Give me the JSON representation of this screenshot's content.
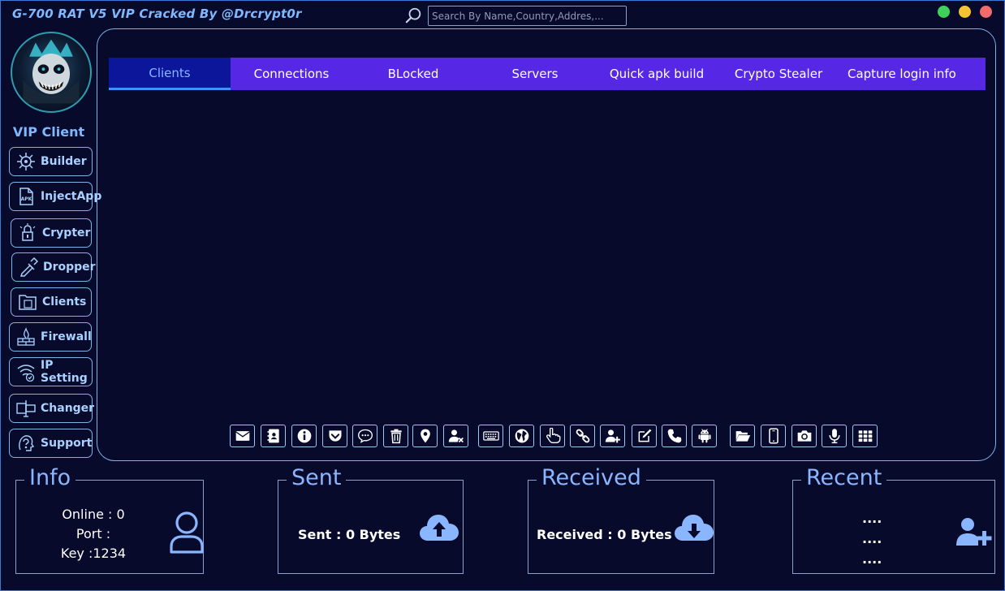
{
  "window": {
    "title": "G-700 RAT V5 VIP Cracked By @Drcrypt0r",
    "controls": [
      "green",
      "yellow",
      "red"
    ],
    "colors": {
      "close": "#f26a6a",
      "minimize": "#f4c430",
      "maximize": "#3ed25c"
    }
  },
  "search": {
    "placeholder": "Search By Name,Country,Addres,...",
    "value": ""
  },
  "sidebar": {
    "logo_text": "G-700 RAT",
    "user_label": "VIP Client",
    "items": [
      {
        "label": "Builder",
        "icon": "virus-icon"
      },
      {
        "label": "InjectApp",
        "icon": "apk-file-icon"
      },
      {
        "label": "Crypter",
        "icon": "lock-icon"
      },
      {
        "label": "Dropper",
        "icon": "dropper-icon"
      },
      {
        "label": "Clients",
        "icon": "folder-icon"
      },
      {
        "label": "Firewall",
        "icon": "firewall-icon"
      },
      {
        "label": "IP Setting",
        "icon": "wifi-check-icon"
      },
      {
        "label": "Changer",
        "icon": "changer-icon"
      },
      {
        "label": "Support",
        "icon": "support-icon"
      }
    ]
  },
  "tabs": [
    {
      "label": "Clients",
      "active": true
    },
    {
      "label": "Connections",
      "active": false
    },
    {
      "label": "BLocked",
      "active": false
    },
    {
      "label": "Servers",
      "active": false
    },
    {
      "label": "Quick apk build",
      "active": false
    },
    {
      "label": "Crypto Stealer",
      "active": false
    },
    {
      "label": "Capture login info",
      "active": false
    }
  ],
  "toolbar": [
    "envelope-icon",
    "contacts-icon",
    "info-icon",
    "pocket-icon",
    "chat-icon",
    "trash-icon",
    "location-icon",
    "user-remove-icon",
    "keyboard-icon",
    "globe-icon",
    "hand-pointer-icon",
    "link-icon",
    "user-add-icon",
    "edit-icon",
    "phone-icon",
    "android-icon",
    "folder-open-icon",
    "mobile-icon",
    "camera-icon",
    "microphone-icon",
    "grid-icon"
  ],
  "stats": {
    "info": {
      "title": "Info",
      "online": "Online : 0",
      "port": "Port :",
      "key": "Key :1234",
      "icon": "user-icon"
    },
    "sent": {
      "title": "Sent",
      "text": "Sent : 0 Bytes",
      "icon": "cloud-upload-icon"
    },
    "received": {
      "title": "Received",
      "text": "Received : 0 Bytes",
      "icon": "cloud-download-icon"
    },
    "recent": {
      "title": "Recent",
      "lines": [
        "....",
        "....",
        "...."
      ],
      "icon": "user-plus-icon"
    }
  },
  "colors": {
    "background": "#070a2a",
    "accent": "#5628e6",
    "active_tab": "#0b169a",
    "border": "#7fb3e8",
    "text_accent": "#8ab6ff"
  }
}
